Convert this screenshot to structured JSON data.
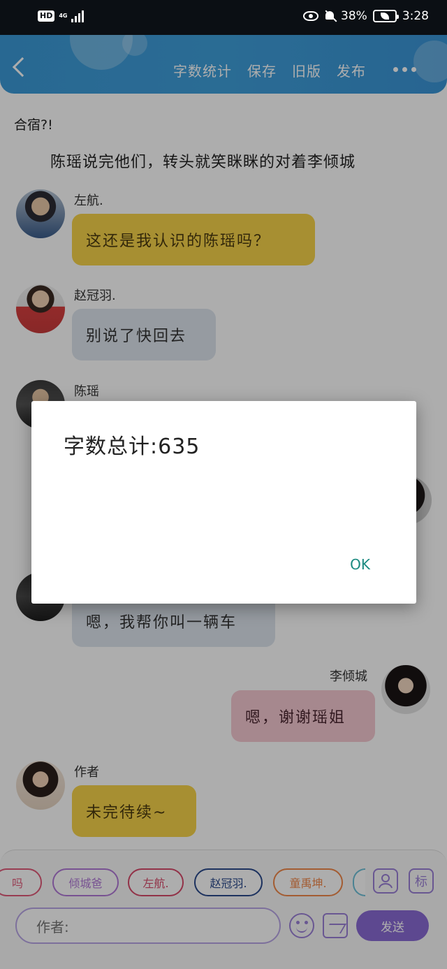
{
  "status_bar": {
    "hd": "HD",
    "network": "4G",
    "battery_percent": "38%",
    "time": "3:28"
  },
  "header": {
    "buttons": [
      "字数统计",
      "保存",
      "旧版",
      "发布"
    ]
  },
  "story": {
    "narration_1": "合宿?!",
    "narration_2": "陈瑶说完他们，转头就笑眯眯的对着李倾城"
  },
  "messages": [
    {
      "name": "左航.",
      "text": "这还是我认识的陈瑶吗？"
    },
    {
      "name": "赵冠羽.",
      "text": "别说了快回去"
    },
    {
      "name": "陈瑶",
      "text": ""
    },
    {
      "name": "",
      "text": "嗯，我帮你叫一辆车"
    },
    {
      "name": "李倾城",
      "text": "嗯，谢谢瑶姐"
    },
    {
      "name": "作者",
      "text": "未完待续~"
    }
  ],
  "role_chips": [
    "吗",
    "倾城爸",
    "左航.",
    "赵冠羽.",
    "童禹坤."
  ],
  "input": {
    "placeholder": "作者:",
    "send_label": "发送",
    "tag_label": "标"
  },
  "dialog": {
    "message": "字数总计:635",
    "ok_label": "OK"
  }
}
